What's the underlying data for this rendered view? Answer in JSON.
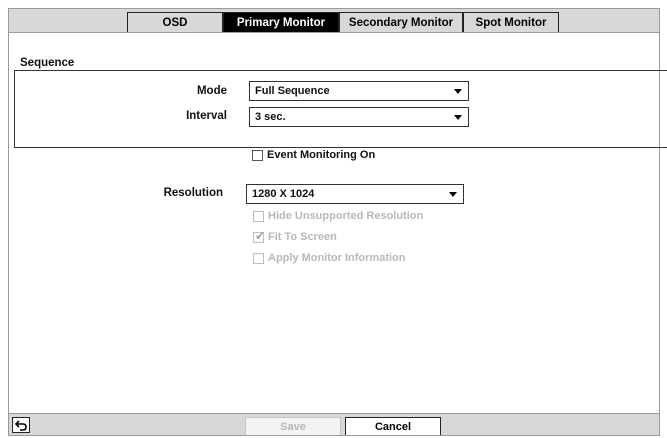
{
  "tabs": [
    {
      "label": "OSD",
      "active": false
    },
    {
      "label": "Primary Monitor",
      "active": true
    },
    {
      "label": "Secondary Monitor",
      "active": false
    },
    {
      "label": "Spot Monitor",
      "active": false
    }
  ],
  "sequence": {
    "title": "Sequence",
    "mode_label": "Mode",
    "mode_value": "Full Sequence",
    "interval_label": "Interval",
    "interval_value": "3 sec."
  },
  "event_monitoring": {
    "label": "Event Monitoring On",
    "checked": false
  },
  "resolution": {
    "label": "Resolution",
    "value": "1280 X 1024",
    "options": [
      {
        "label": "Hide Unsupported Resolution",
        "checked": false,
        "enabled": false
      },
      {
        "label": "Fit To Screen",
        "checked": true,
        "enabled": false
      },
      {
        "label": "Apply Monitor Information",
        "checked": false,
        "enabled": false
      }
    ]
  },
  "footer": {
    "back_icon": "return-arrow-icon",
    "save_label": "Save",
    "save_enabled": false,
    "cancel_label": "Cancel"
  },
  "colors": {
    "active_tab_bg": "#000000",
    "bar_bg": "#d8d8d8",
    "disabled_text": "#b8b8b8"
  }
}
